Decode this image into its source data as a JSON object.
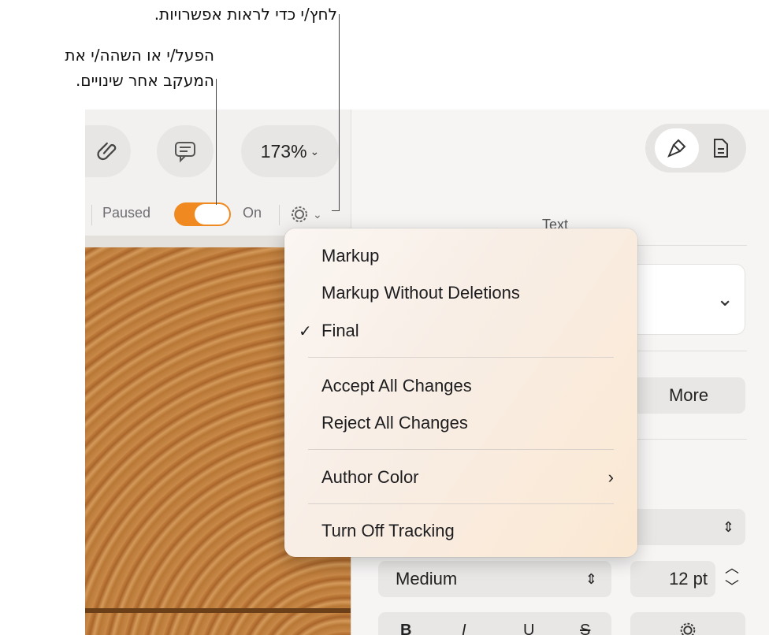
{
  "callouts": {
    "options_hint": "לחץ/י כדי לראות אפשרויות.",
    "tracking_hint_line1": "הפעל/י או השהה/י את",
    "tracking_hint_line2": "המעקב אחר שינויים."
  },
  "toolbar": {
    "attach_icon": "paperclip-icon",
    "comment_icon": "comment-icon",
    "zoom_value": "173%",
    "share_icon": "share-icon",
    "format_icon": "paintbrush-icon",
    "document_icon": "document-icon"
  },
  "tracking_bar": {
    "paused_label": "Paused",
    "on_label": "On",
    "toggle_state": "on",
    "options_icon": "gear-icon"
  },
  "sidebar": {
    "section_title": "Text",
    "more_button": "More",
    "font_weight": "Medium",
    "font_size": "12 pt",
    "style_bold": "B",
    "style_italic": "I",
    "style_underline": "U",
    "style_strike": "S"
  },
  "menu": {
    "items": [
      {
        "label": "Markup",
        "checked": false
      },
      {
        "label": "Markup Without Deletions",
        "checked": false
      },
      {
        "label": "Final",
        "checked": true
      },
      {
        "label": "Accept All Changes",
        "checked": false
      },
      {
        "label": "Reject All Changes",
        "checked": false
      },
      {
        "label": "Author Color",
        "checked": false,
        "submenu": true
      },
      {
        "label": "Turn Off Tracking",
        "checked": false
      }
    ],
    "check_glyph": "✓",
    "submenu_glyph": "›"
  },
  "colors": {
    "toggle_on": "#f08a20",
    "menu_bg": "#fbefe4"
  }
}
